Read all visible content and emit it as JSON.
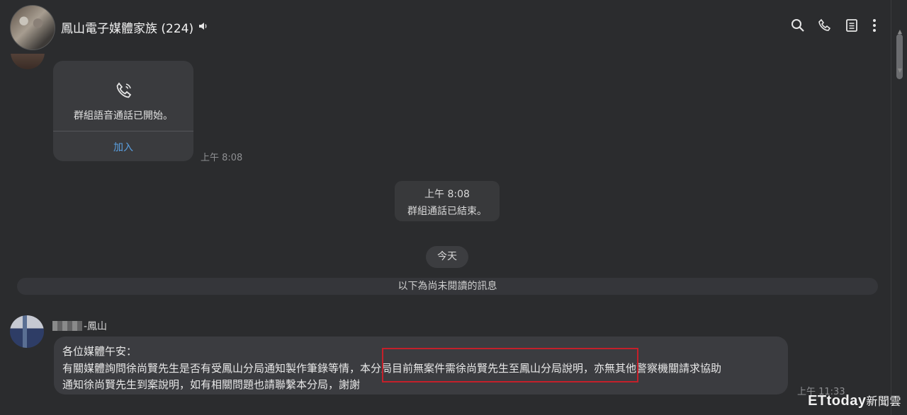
{
  "header": {
    "group_name": "鳳山電子媒體家族 (224)",
    "icons": [
      "speaker-icon",
      "search-icon",
      "phone-icon",
      "notes-icon",
      "more-icon"
    ]
  },
  "call_card": {
    "text": "群組語音通話已開始。",
    "join_label": "加入",
    "time": "上午 8:08"
  },
  "system_message": {
    "time": "上午 8:08",
    "text": "群組通話已結束。"
  },
  "date_separator": "今天",
  "unread_bar": "以下為尚未閱讀的訊息",
  "message": {
    "sender_suffix": "-鳳山",
    "line1": "各位媒體午安：",
    "line2": "有關媒體詢問徐尚賢先生是否有受鳳山分局通知製作筆錄等情，本分局目前無案件需徐尚賢先生至鳳山分局說明，亦無其他警察機關請求協助",
    "line3": "通知徐尚賢先生到案說明，如有相關問題也請聯繫本分局，謝謝",
    "time": "上午 11:33"
  },
  "watermark": {
    "brand": "ETtoday",
    "suffix": "新聞雲"
  },
  "colors": {
    "background": "#2b2c2e",
    "bubble": "#3b3c40",
    "link": "#5a9fe0",
    "highlight": "#c4202a"
  }
}
